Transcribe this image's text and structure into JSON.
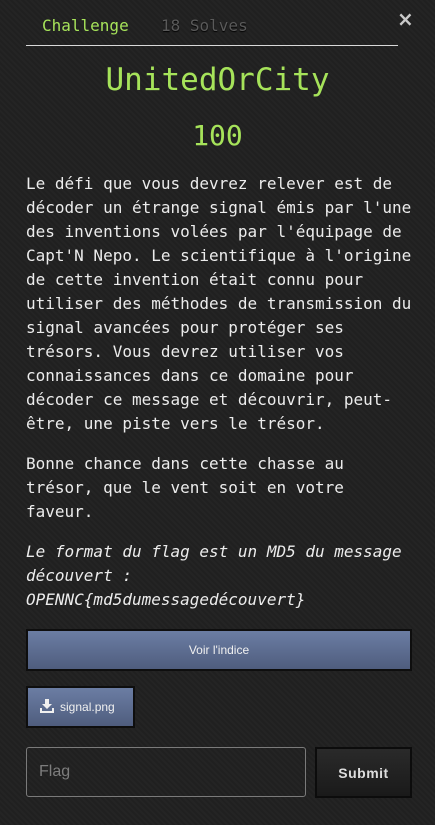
{
  "tabs": {
    "challenge": "Challenge",
    "solves": "18 Solves"
  },
  "close_label": "×",
  "challenge": {
    "title": "UnitedOrCity",
    "points": "100",
    "description": [
      "Le défi que vous devrez relever est de\ndécoder un étrange signal émis par l'une\ndes inventions volées par l'équipage de\nCapt'N Nepo. Le scientifique à l'origine\nde cette invention était connu pour\nutiliser des méthodes de transmission du\nsignal avancées pour protéger ses\ntrésors. Vous devrez utiliser vos\nconnaissances dans ce domaine pour\ndécoder ce message et découvrir, peut-\nêtre, une piste vers le trésor.",
      "Bonne chance dans cette chasse au\ntrésor, que le vent soit en votre\nfaveur."
    ],
    "flag_format": "Le format du flag est un MD5 du message\ndécouvert :\nOPENNC{md5dumessagedécouvert}"
  },
  "actions": {
    "hint_label": "Voir l'indice",
    "file_label": "signal.png",
    "flag_placeholder": "Flag",
    "flag_value": "",
    "submit_label": "Submit"
  },
  "colors": {
    "background": "#212121",
    "accent": "#a6e35a",
    "button": "#5d6c8f"
  },
  "icons": {
    "close": "close-icon",
    "download": "download-icon"
  }
}
